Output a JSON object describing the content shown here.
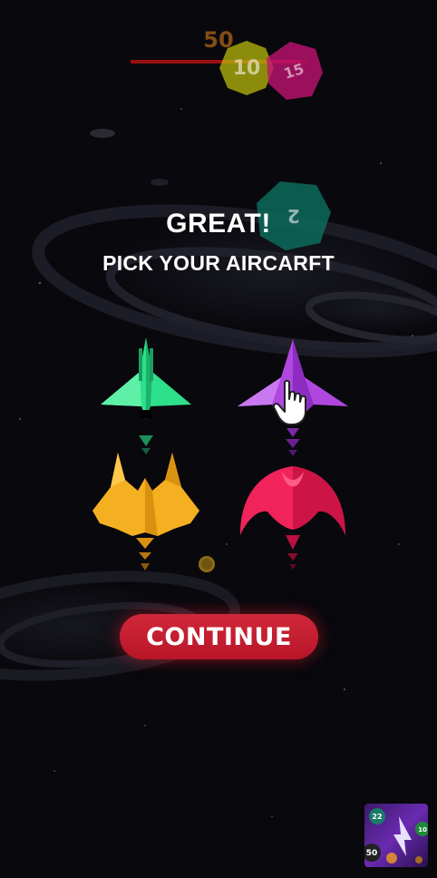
{
  "hud": {
    "score": "50",
    "progress_fraction": 0.97
  },
  "balls": [
    {
      "label": "10",
      "color": "#c8c80c"
    },
    {
      "label": "15",
      "color": "#c8157a"
    },
    {
      "label": "2",
      "color": "#0f7a6a"
    }
  ],
  "dialog": {
    "headline": "GREAT!",
    "subline": "PICK YOUR AIRCARFT"
  },
  "aircraft_options": [
    {
      "id": "green",
      "color": "#2ee08a"
    },
    {
      "id": "purple",
      "color": "#b048e0"
    },
    {
      "id": "yellow",
      "color": "#f5b021"
    },
    {
      "id": "red",
      "color": "#f0245a"
    }
  ],
  "continue_button": {
    "label": "CONTINUE"
  },
  "ad_thumbnail": {
    "badge_top": "22",
    "badge_bottom": "50",
    "badge_right": "10"
  },
  "colors": {
    "accent_button": "#c8202f",
    "headline": "#ffffff"
  }
}
